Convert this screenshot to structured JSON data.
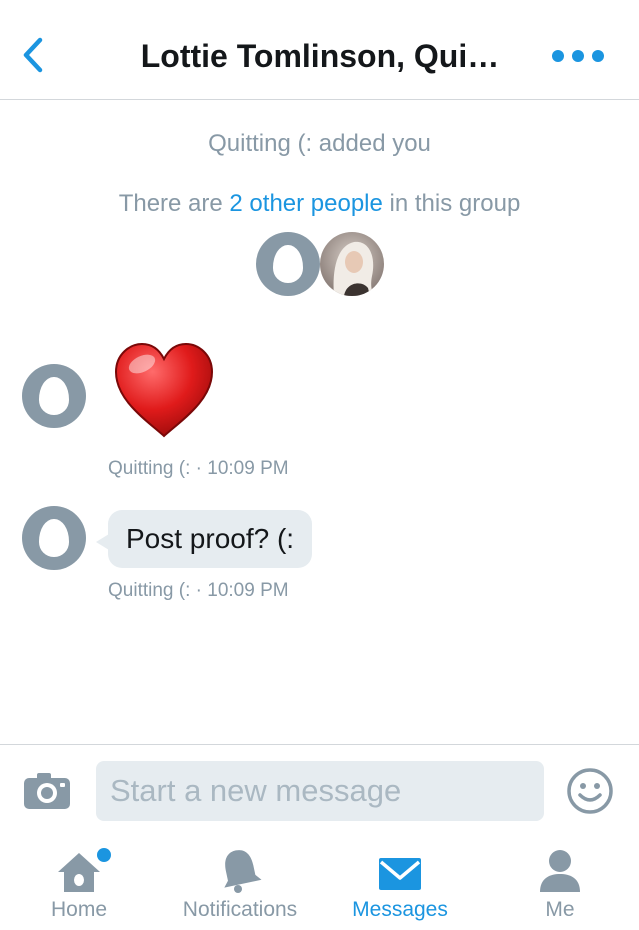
{
  "header": {
    "title": "Lottie Tomlinson, Qui…"
  },
  "system": {
    "added_text": "Quitting (: added you",
    "group_prefix": "There are ",
    "group_link": "2 other people",
    "group_suffix": " in this group"
  },
  "messages": [
    {
      "type": "emoji",
      "content": "❤",
      "meta": "Quitting (: · 10:09 PM"
    },
    {
      "type": "text",
      "content": "Post proof? (:",
      "meta": "Quitting (: · 10:09 PM"
    }
  ],
  "composer": {
    "placeholder": "Start a new message"
  },
  "tabs": [
    {
      "label": "Home",
      "icon": "home-icon",
      "active": false,
      "has_badge": true
    },
    {
      "label": "Notifications",
      "icon": "bell-icon",
      "active": false,
      "has_badge": false
    },
    {
      "label": "Messages",
      "icon": "envelope-icon",
      "active": true,
      "has_badge": false
    },
    {
      "label": "Me",
      "icon": "person-icon",
      "active": false,
      "has_badge": false
    }
  ],
  "colors": {
    "accent": "#1b95e0",
    "muted": "#8899a6",
    "bubble": "#e6ecf0",
    "text": "#14171a"
  }
}
